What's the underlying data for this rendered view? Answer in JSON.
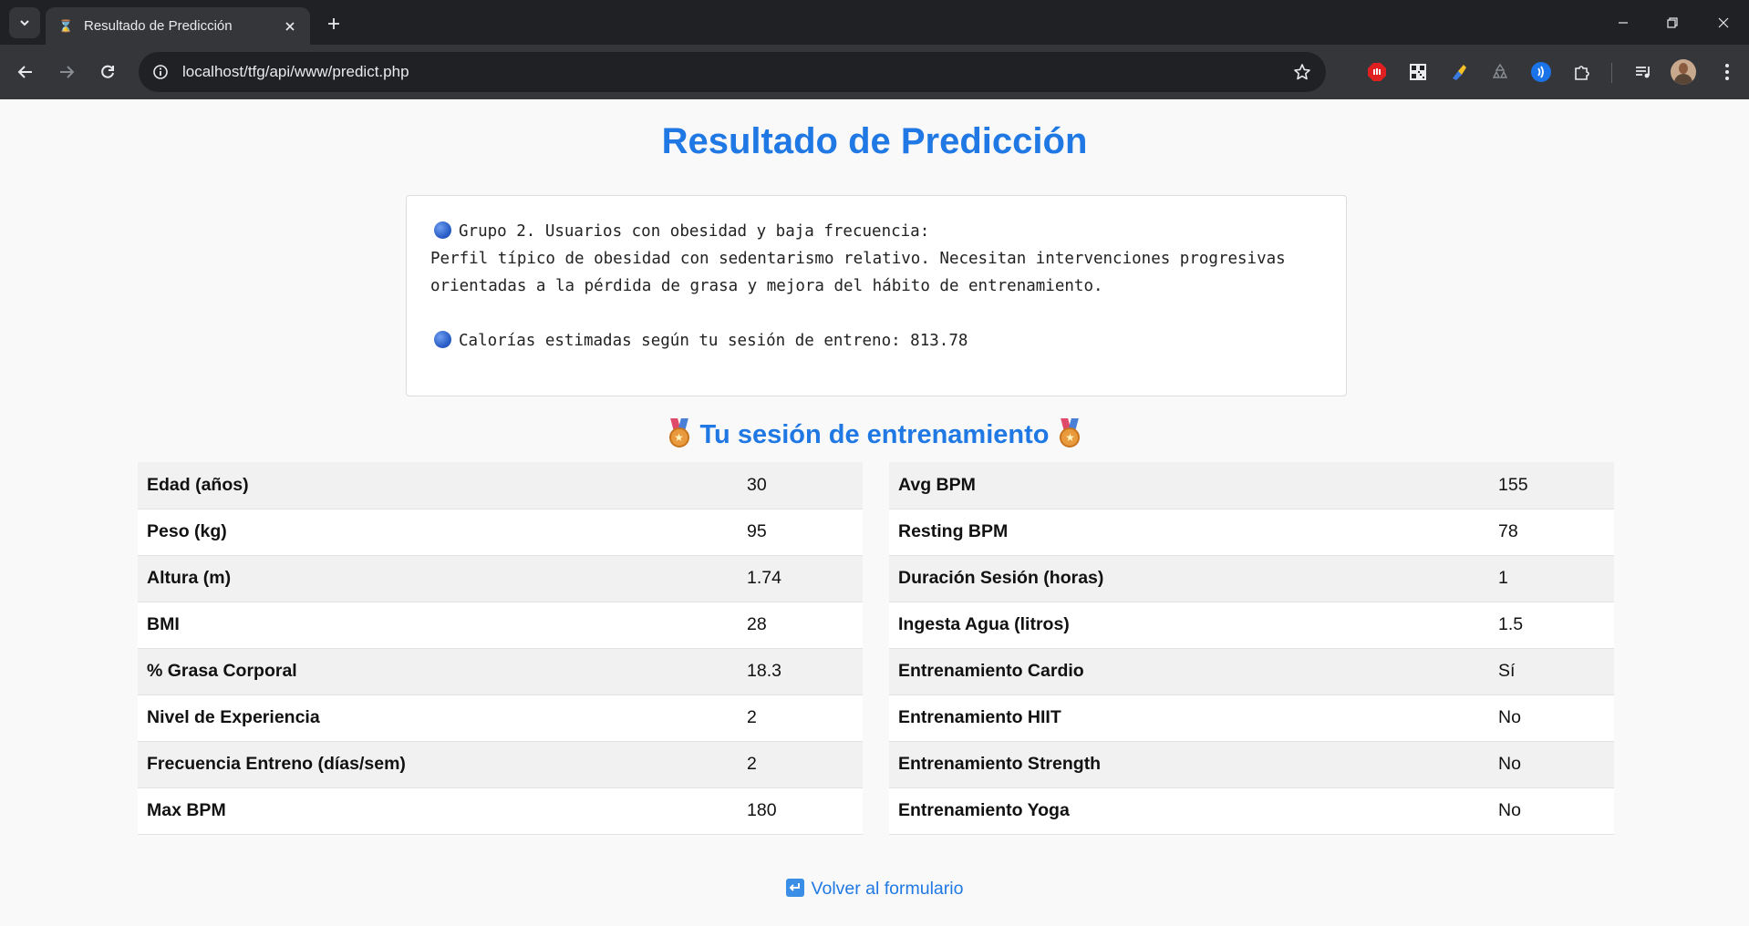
{
  "browser": {
    "tab_title": "Resultado de Predicción",
    "url": "localhost/tfg/api/www/predict.php"
  },
  "page": {
    "title": "Resultado de Predicción",
    "result": {
      "group_line": "Grupo 2. Usuarios con obesidad y baja frecuencia:",
      "description_line1": "Perfil típico de obesidad con sedentarismo relativo. Necesitan intervenciones progresivas",
      "description_line2": "orientadas a la pérdida de grasa y mejora del hábito de entrenamiento.",
      "calories_line": "Calorías estimadas según tu sesión de entreno: 813.78"
    },
    "section_title": "Tu sesión de entrenamiento",
    "left_table": [
      {
        "label": "Edad (años)",
        "value": "30"
      },
      {
        "label": "Peso (kg)",
        "value": "95"
      },
      {
        "label": "Altura (m)",
        "value": "1.74"
      },
      {
        "label": "BMI",
        "value": "28"
      },
      {
        "label": "% Grasa Corporal",
        "value": "18.3"
      },
      {
        "label": "Nivel de Experiencia",
        "value": "2"
      },
      {
        "label": "Frecuencia Entreno (días/sem)",
        "value": "2"
      },
      {
        "label": "Max BPM",
        "value": "180"
      }
    ],
    "right_table": [
      {
        "label": "Avg BPM",
        "value": "155"
      },
      {
        "label": "Resting BPM",
        "value": "78"
      },
      {
        "label": "Duración Sesión (horas)",
        "value": "1"
      },
      {
        "label": "Ingesta Agua (litros)",
        "value": "1.5"
      },
      {
        "label": "Entrenamiento Cardio",
        "value": "Sí"
      },
      {
        "label": "Entrenamiento HIIT",
        "value": "No"
      },
      {
        "label": "Entrenamiento Strength",
        "value": "No"
      },
      {
        "label": "Entrenamiento Yoga",
        "value": "No"
      }
    ],
    "back_link": "Volver al formulario"
  },
  "icons": {
    "tab_favicon": "hourglass-icon",
    "result_bullets": "blue-circle-icon",
    "section_decoration": "medal-icon",
    "back_link": "return-arrow-icon"
  },
  "colors": {
    "accent": "#1f78e3",
    "chrome_dark": "#202124",
    "chrome_toolbar": "#35363a"
  }
}
